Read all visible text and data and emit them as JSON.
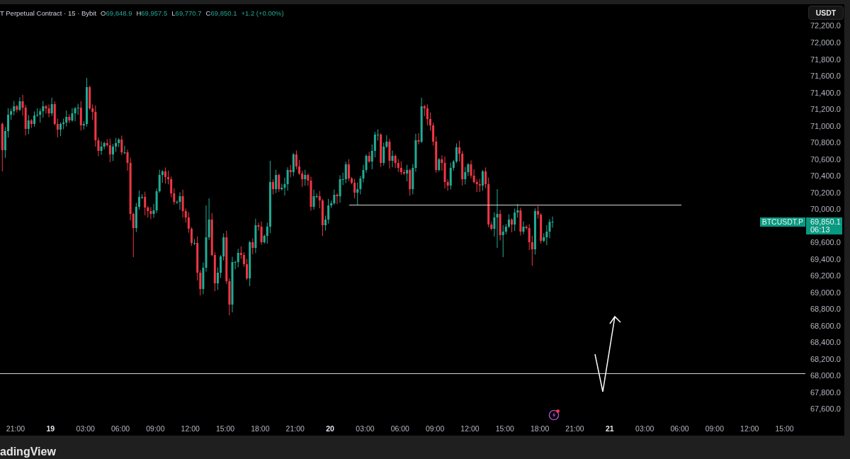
{
  "legend": {
    "title": "T Perpetual Contract · 15 · Bybit",
    "ohlc": [
      {
        "label": "O",
        "value": "69,848.9"
      },
      {
        "label": "H",
        "value": "69,957.5"
      },
      {
        "label": "L",
        "value": "69,770.7"
      },
      {
        "label": "C",
        "value": "69,850.1"
      }
    ],
    "change": "+1.2 (+0.00%)"
  },
  "currency_button": {
    "label": "USDT"
  },
  "price_axis": [
    {
      "kind": "tick",
      "label": "72,200.0"
    },
    {
      "kind": "tick",
      "label": "72,000.0"
    },
    {
      "kind": "tick",
      "label": "71,800.0"
    },
    {
      "kind": "tick",
      "label": "71,600.0"
    },
    {
      "kind": "tick",
      "label": "71,400.0"
    },
    {
      "kind": "tick",
      "label": "71,200.0"
    },
    {
      "kind": "tick",
      "label": "71,000.0"
    },
    {
      "kind": "tick",
      "label": "70,800.0"
    },
    {
      "kind": "tick",
      "label": "70,600.0"
    },
    {
      "kind": "tick",
      "label": "70,400.0"
    },
    {
      "kind": "tick",
      "label": "70,200.0"
    },
    {
      "kind": "tick",
      "label": "70,000.0"
    },
    {
      "kind": "last_price",
      "symbol": "BTCUSDT.P",
      "price": "69,850.1",
      "countdown": "06:13"
    },
    {
      "kind": "tick",
      "label": "69,600.0"
    },
    {
      "kind": "tick",
      "label": "69,400.0"
    },
    {
      "kind": "tick",
      "label": "69,200.0"
    },
    {
      "kind": "tick",
      "label": "69,000.0"
    },
    {
      "kind": "tick",
      "label": "68,800.0"
    },
    {
      "kind": "tick",
      "label": "68,600.0"
    },
    {
      "kind": "tick",
      "label": "68,400.0"
    },
    {
      "kind": "tick",
      "label": "68,200.0"
    },
    {
      "kind": "tick",
      "label": "68,000.0"
    },
    {
      "kind": "tick",
      "label": "67,800.0"
    },
    {
      "kind": "tick",
      "label": "67,600.0"
    }
  ],
  "time_axis": [
    {
      "kind": "time",
      "label": "21:00"
    },
    {
      "kind": "date",
      "label": "19"
    },
    {
      "kind": "time",
      "label": "03:00"
    },
    {
      "kind": "time",
      "label": "06:00"
    },
    {
      "kind": "time",
      "label": "09:00"
    },
    {
      "kind": "time",
      "label": "12:00"
    },
    {
      "kind": "time",
      "label": "15:00"
    },
    {
      "kind": "time",
      "label": "18:00"
    },
    {
      "kind": "time",
      "label": "21:00"
    },
    {
      "kind": "date",
      "label": "20"
    },
    {
      "kind": "time",
      "label": "03:00"
    },
    {
      "kind": "time",
      "label": "06:00"
    },
    {
      "kind": "time",
      "label": "09:00"
    },
    {
      "kind": "time",
      "label": "12:00"
    },
    {
      "kind": "time",
      "label": "15:00"
    },
    {
      "kind": "time",
      "label": "18:00"
    },
    {
      "kind": "time",
      "label": "21:00"
    },
    {
      "kind": "date",
      "label": "21"
    },
    {
      "kind": "time",
      "label": "03:00"
    },
    {
      "kind": "time",
      "label": "06:00"
    },
    {
      "kind": "time",
      "label": "09:00"
    },
    {
      "kind": "time",
      "label": "12:00"
    },
    {
      "kind": "time",
      "label": "15:00"
    }
  ],
  "footer": {
    "wordmark": "adingView"
  }
}
